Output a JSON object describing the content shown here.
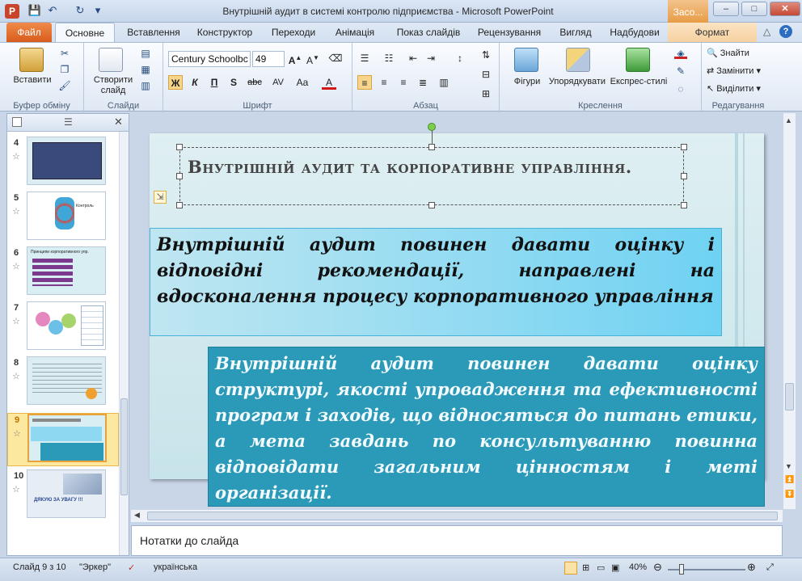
{
  "window": {
    "title": "Внутрішній аудит  в системі контролю підприємства  -  Microsoft PowerPoint",
    "context_tab": "Засо...",
    "controls": {
      "minimize": "–",
      "maximize": "□",
      "close": "✕"
    }
  },
  "qat": {
    "save_icon": "💾",
    "undo_icon": "↶",
    "redo_icon": "↻",
    "customize_icon": "▾"
  },
  "tabs": [
    "Файл",
    "Основне",
    "Вставлення",
    "Конструктор",
    "Переходи",
    "Анімація",
    "Показ слайдів",
    "Рецензування",
    "Вигляд",
    "Надбудови",
    "Формат"
  ],
  "ribbon": {
    "clipboard": {
      "label": "Буфер обміну",
      "paste": "Вставити"
    },
    "slides": {
      "label": "Слайди",
      "new_slide": "Створити\nслайд"
    },
    "font": {
      "label": "Шрифт",
      "font_name": "Century Schoolbc",
      "font_size": "49",
      "bold": "Ж",
      "italic": "К",
      "underline": "П",
      "shadow": "S",
      "strike": "abc",
      "spacing": "AV",
      "case": "Aa",
      "color": "A"
    },
    "paragraph": {
      "label": "Абзац"
    },
    "drawing": {
      "label": "Креслення",
      "shapes": "Фігури",
      "arrange": "Упорядкувати",
      "styles": "Експрес-стилі"
    },
    "editing": {
      "label": "Редагування",
      "find": "Знайти",
      "replace": "Замінити",
      "select": "Виділити"
    }
  },
  "slides_panel": {
    "thumbs": [
      {
        "num": "4"
      },
      {
        "num": "5"
      },
      {
        "num": "6"
      },
      {
        "num": "7"
      },
      {
        "num": "8"
      },
      {
        "num": "9"
      },
      {
        "num": "10"
      }
    ],
    "thumb5_label": "Контроль",
    "thumb6_label": "Принципи корпоративного упр.",
    "thumb10_label": "ДЯКУЮ ЗА УВАГУ !!!"
  },
  "slide": {
    "title": "Внутрішній аудит та корпоративне управління.",
    "box1": "Внутрішній аудит повинен давати оцінку і відповідні рекомендації, направлені на вдосконалення процесу корпоративного управління",
    "box2": "Внутрішній аудит повинен давати оцінку структурі, якості упровадження та ефективності програм і заходів, що відносяться до питань етики, а мета завдань по консультуванню повинна відповідати загальним цінностям і меті організації."
  },
  "notes": {
    "placeholder": "Нотатки до слайда"
  },
  "status": {
    "slide_of": "Слайд 9 з 10",
    "theme": "\"Эркер\"",
    "language": "українська",
    "zoom": "40%"
  },
  "colors": {
    "box2_bg": "#2b9ab9",
    "file_tab": "#d85c1c",
    "slide_bg": "#cfe8ee"
  }
}
